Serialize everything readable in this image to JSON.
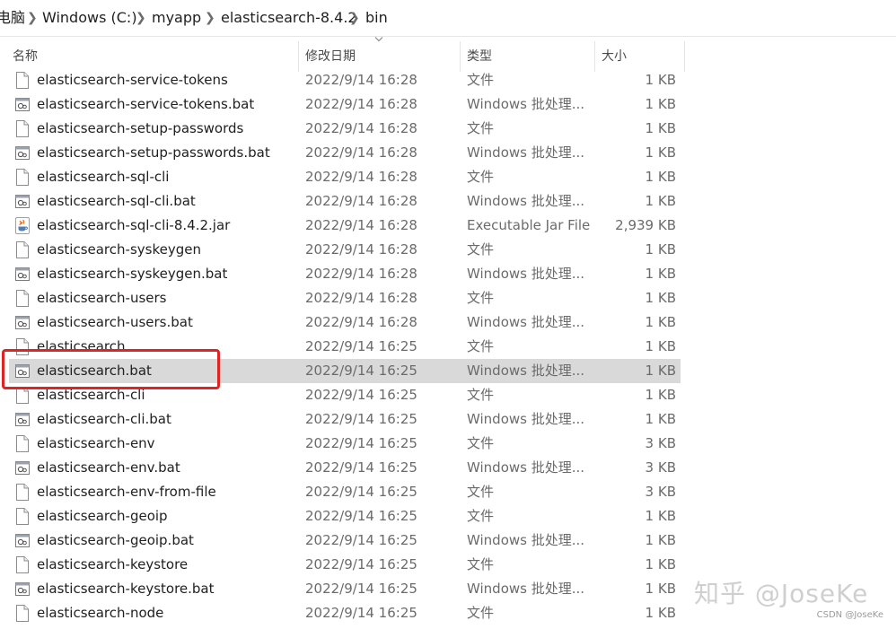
{
  "breadcrumb": {
    "items": [
      "电脑",
      "Windows (C:)",
      "myapp",
      "elasticsearch-8.4.2",
      "bin"
    ]
  },
  "columns": {
    "name": "名称",
    "date": "修改日期",
    "type": "类型",
    "size": "大小"
  },
  "files": [
    {
      "name": "elasticsearch-service-tokens",
      "date": "2022/9/14 16:28",
      "type": "文件",
      "size": "1 KB",
      "icon": "file-icon"
    },
    {
      "name": "elasticsearch-service-tokens.bat",
      "date": "2022/9/14 16:28",
      "type": "Windows 批处理...",
      "size": "1 KB",
      "icon": "batch-file-icon"
    },
    {
      "name": "elasticsearch-setup-passwords",
      "date": "2022/9/14 16:28",
      "type": "文件",
      "size": "1 KB",
      "icon": "file-icon"
    },
    {
      "name": "elasticsearch-setup-passwords.bat",
      "date": "2022/9/14 16:28",
      "type": "Windows 批处理...",
      "size": "1 KB",
      "icon": "batch-file-icon"
    },
    {
      "name": "elasticsearch-sql-cli",
      "date": "2022/9/14 16:28",
      "type": "文件",
      "size": "1 KB",
      "icon": "file-icon"
    },
    {
      "name": "elasticsearch-sql-cli.bat",
      "date": "2022/9/14 16:28",
      "type": "Windows 批处理...",
      "size": "1 KB",
      "icon": "batch-file-icon"
    },
    {
      "name": "elasticsearch-sql-cli-8.4.2.jar",
      "date": "2022/9/14 16:28",
      "type": "Executable Jar File",
      "size": "2,939 KB",
      "icon": "java-jar-icon"
    },
    {
      "name": "elasticsearch-syskeygen",
      "date": "2022/9/14 16:28",
      "type": "文件",
      "size": "1 KB",
      "icon": "file-icon"
    },
    {
      "name": "elasticsearch-syskeygen.bat",
      "date": "2022/9/14 16:28",
      "type": "Windows 批处理...",
      "size": "1 KB",
      "icon": "batch-file-icon"
    },
    {
      "name": "elasticsearch-users",
      "date": "2022/9/14 16:28",
      "type": "文件",
      "size": "1 KB",
      "icon": "file-icon"
    },
    {
      "name": "elasticsearch-users.bat",
      "date": "2022/9/14 16:28",
      "type": "Windows 批处理...",
      "size": "1 KB",
      "icon": "batch-file-icon"
    },
    {
      "name": "elasticsearch",
      "date": "2022/9/14 16:25",
      "type": "文件",
      "size": "1 KB",
      "icon": "file-icon"
    },
    {
      "name": "elasticsearch.bat",
      "date": "2022/9/14 16:25",
      "type": "Windows 批处理...",
      "size": "1 KB",
      "icon": "batch-file-icon",
      "selected": true
    },
    {
      "name": "elasticsearch-cli",
      "date": "2022/9/14 16:25",
      "type": "文件",
      "size": "1 KB",
      "icon": "file-icon"
    },
    {
      "name": "elasticsearch-cli.bat",
      "date": "2022/9/14 16:25",
      "type": "Windows 批处理...",
      "size": "1 KB",
      "icon": "batch-file-icon"
    },
    {
      "name": "elasticsearch-env",
      "date": "2022/9/14 16:25",
      "type": "文件",
      "size": "3 KB",
      "icon": "file-icon"
    },
    {
      "name": "elasticsearch-env.bat",
      "date": "2022/9/14 16:25",
      "type": "Windows 批处理...",
      "size": "3 KB",
      "icon": "batch-file-icon"
    },
    {
      "name": "elasticsearch-env-from-file",
      "date": "2022/9/14 16:25",
      "type": "文件",
      "size": "3 KB",
      "icon": "file-icon"
    },
    {
      "name": "elasticsearch-geoip",
      "date": "2022/9/14 16:25",
      "type": "文件",
      "size": "1 KB",
      "icon": "file-icon"
    },
    {
      "name": "elasticsearch-geoip.bat",
      "date": "2022/9/14 16:25",
      "type": "Windows 批处理...",
      "size": "1 KB",
      "icon": "batch-file-icon"
    },
    {
      "name": "elasticsearch-keystore",
      "date": "2022/9/14 16:25",
      "type": "文件",
      "size": "1 KB",
      "icon": "file-icon"
    },
    {
      "name": "elasticsearch-keystore.bat",
      "date": "2022/9/14 16:25",
      "type": "Windows 批处理...",
      "size": "1 KB",
      "icon": "batch-file-icon"
    },
    {
      "name": "elasticsearch-node",
      "date": "2022/9/14 16:25",
      "type": "文件",
      "size": "1 KB",
      "icon": "file-icon"
    }
  ],
  "annotation": {
    "highlight_color": "#e02424",
    "selection_color": "#d9d9d9"
  },
  "watermark": {
    "text": "知乎 @JoseKe",
    "credit": "CSDN @JoseKe"
  }
}
